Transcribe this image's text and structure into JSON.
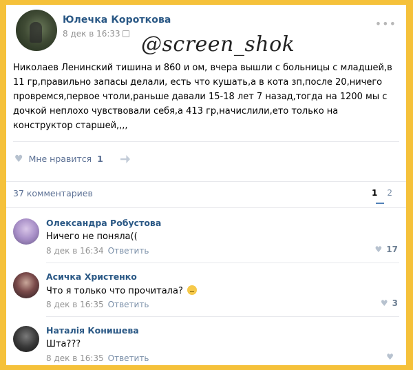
{
  "post": {
    "author": "Юлечка Короткова",
    "date": "8 дек в 16:33",
    "watermark": "@screen_shok",
    "text": "Николаев Ленинский тишина и 860 и ом, вчера вышли с больницы с младшей,в 11 гр,правильно запасы делали, есть что кушать,а в кота зп,после 20,ничего провремся,первое чтоли,раньше давали 15-18 лет 7 назад,тогда на 1200 мы с дочкой неплохо чувствовали себя,а 413 гр,начислили,ето только на конструктор старшей,,,,",
    "like_label": "Мне нравится",
    "like_count": "1"
  },
  "comments_header": {
    "count_label": "37 комментариев",
    "pages": [
      "1",
      "2"
    ]
  },
  "comments": [
    {
      "name": "Олександра Робустова",
      "text": "Ничего не поняла((",
      "date": "8 дек в 16:34",
      "reply": "Ответить",
      "likes": "17",
      "avatar_color": "#a88fc7"
    },
    {
      "name": "Асичка Христенко",
      "text": "Что я только что прочитала?",
      "date": "8 дек в 16:35",
      "reply": "Ответить",
      "likes": "3",
      "avatar_color": "#4b3a3a"
    },
    {
      "name": "Наталія Конишева",
      "text": "Шта???",
      "date": "8 дек в 16:35",
      "reply": "Ответить",
      "likes": "",
      "avatar_color": "#2b2b2b"
    }
  ]
}
